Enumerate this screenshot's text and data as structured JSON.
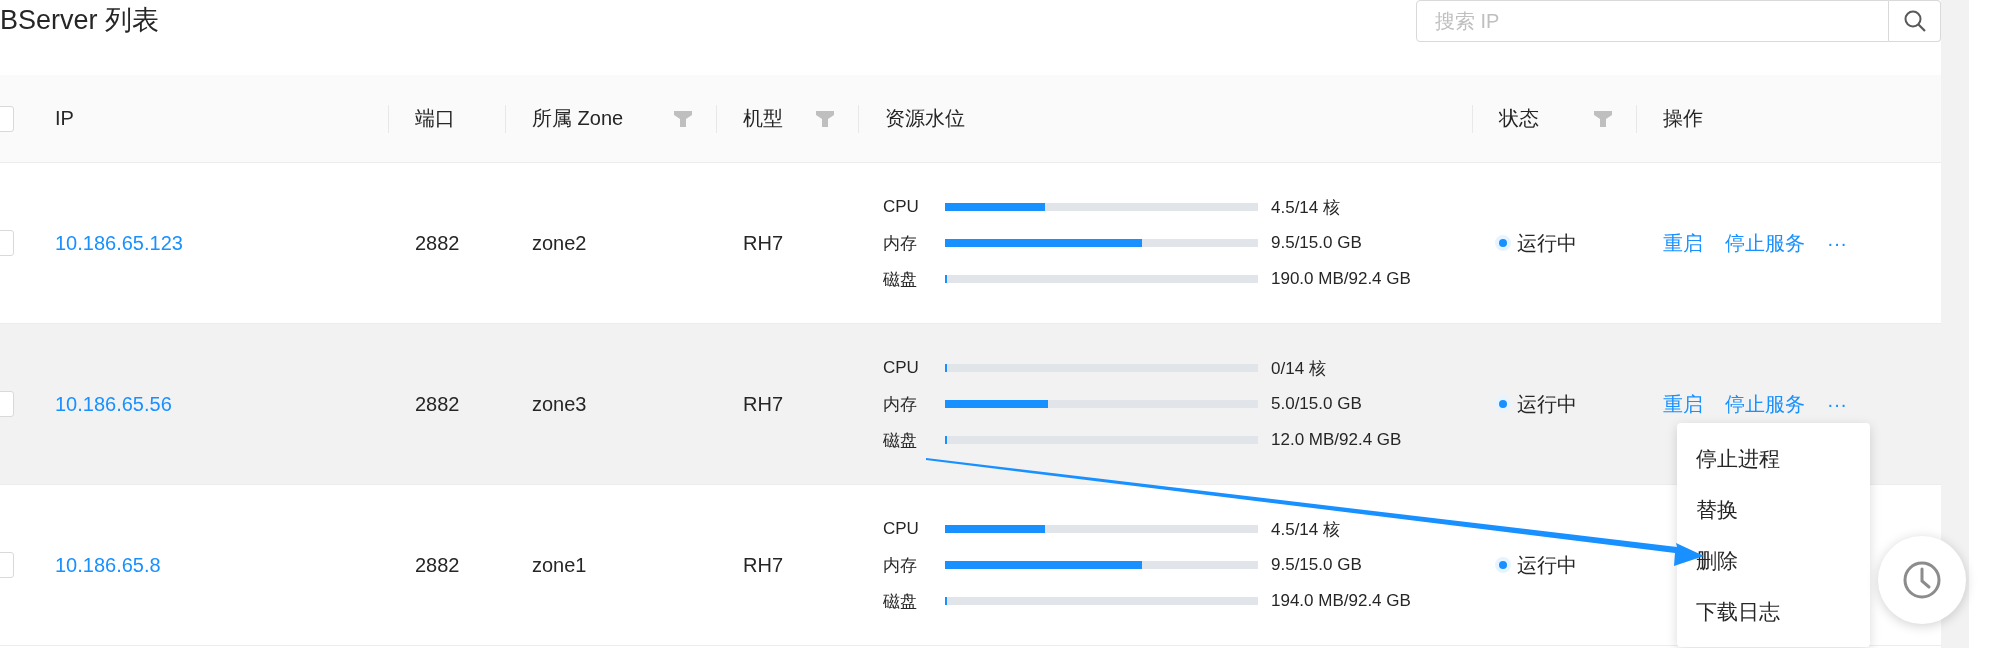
{
  "page": {
    "title": "BServer 列表"
  },
  "search": {
    "placeholder": "搜索 IP"
  },
  "table": {
    "select_all_checked": false,
    "columns": [
      {
        "label": "IP",
        "filter": false
      },
      {
        "label": "端口",
        "filter": false
      },
      {
        "label": "所属 Zone",
        "filter": true
      },
      {
        "label": "机型",
        "filter": true
      },
      {
        "label": "资源水位",
        "filter": false
      },
      {
        "label": "状态",
        "filter": true
      },
      {
        "label": "操作",
        "filter": false
      }
    ],
    "rows": [
      {
        "checked": false,
        "highlighted": false,
        "ip": "10.186.65.123",
        "port": "2882",
        "zone": "zone2",
        "model": "RH7",
        "resources": [
          {
            "label": "CPU",
            "level": 0.32,
            "reading": "4.5/14 核"
          },
          {
            "label": "内存",
            "level": 0.63,
            "reading": "9.5/15.0 GB"
          },
          {
            "label": "磁盘",
            "level": 0.004,
            "reading": "190.0 MB/92.4 GB"
          }
        ],
        "status": "运行中",
        "actions": [
          "重启",
          "停止服务",
          "···"
        ]
      },
      {
        "checked": false,
        "highlighted": true,
        "ip": "10.186.65.56",
        "port": "2882",
        "zone": "zone3",
        "model": "RH7",
        "resources": [
          {
            "label": "CPU",
            "level": 0,
            "reading": "0/14 核"
          },
          {
            "label": "内存",
            "level": 0.33,
            "reading": "5.0/15.0 GB"
          },
          {
            "label": "磁盘",
            "level": 0,
            "reading": "12.0 MB/92.4 GB"
          }
        ],
        "status": "运行中",
        "actions": [
          "重启",
          "停止服务",
          "···"
        ]
      },
      {
        "checked": false,
        "highlighted": false,
        "ip": "10.186.65.8",
        "port": "2882",
        "zone": "zone1",
        "model": "RH7",
        "resources": [
          {
            "label": "CPU",
            "level": 0.32,
            "reading": "4.5/14 核"
          },
          {
            "label": "内存",
            "level": 0.63,
            "reading": "9.5/15.0 GB"
          },
          {
            "label": "磁盘",
            "level": 0.004,
            "reading": "194.0 MB/92.4 GB"
          }
        ],
        "status": "运行中"
      }
    ]
  },
  "action_menu": {
    "items": [
      "停止进程",
      "替换",
      "删除",
      "下载日志"
    ]
  }
}
